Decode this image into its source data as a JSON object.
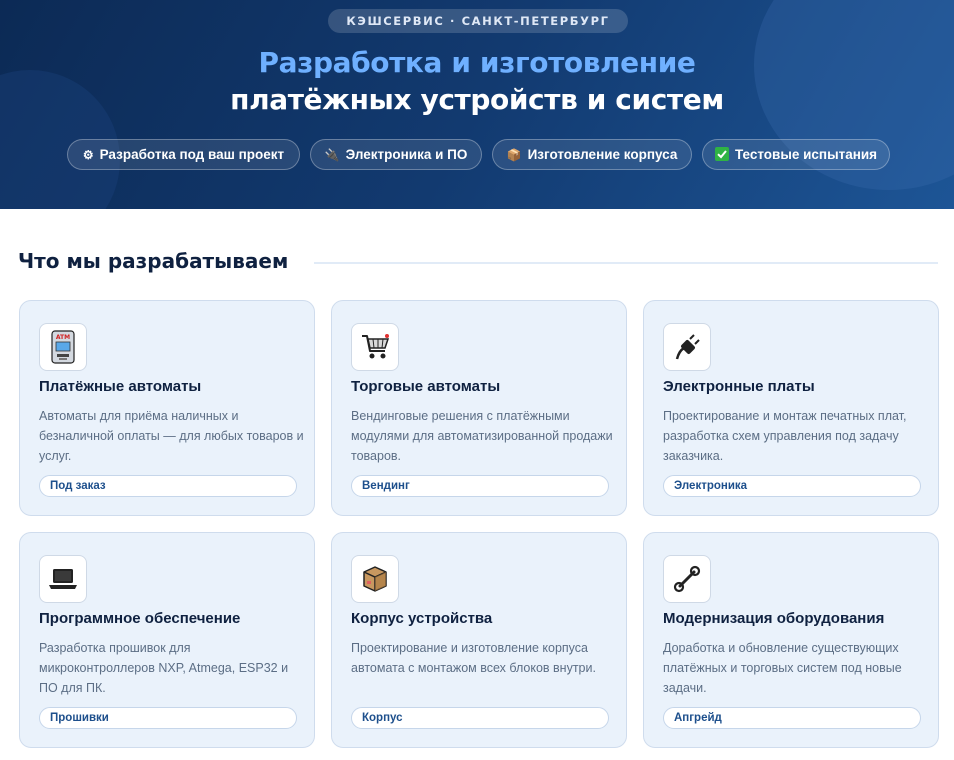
{
  "hero": {
    "badge": "КЭШСЕРВИС · САНКТ-ПЕТЕРБУРГ",
    "title_line1": "Разработка и изготовление",
    "title_line2": "платёжных устройств и систем",
    "chips": [
      {
        "icon": "⚙",
        "icon_name": "gear-icon",
        "label": "Разработка под ваш проект"
      },
      {
        "icon": "🔌",
        "icon_name": "plug-icon",
        "label": "Электроника и ПО"
      },
      {
        "icon": "📦",
        "icon_name": "box-icon",
        "label": "Изготовление корпуса"
      },
      {
        "icon": "✔",
        "icon_name": "checkmark-icon",
        "label": "Тестовые испытания"
      }
    ]
  },
  "section": {
    "title": "Что мы разрабатываем"
  },
  "cards": [
    {
      "icon_name": "atm-icon",
      "title": "Платёжные автоматы",
      "description": "Автоматы для приёма наличных и безналичной оплаты — для любых товаров и услуг.",
      "tag": "Под заказ",
      "atm_label": "ATM"
    },
    {
      "icon_name": "shopping-cart-icon",
      "title": "Торговые автоматы",
      "description": "Вендинговые решения с платёжными модулями для автоматизированной продажи товаров.",
      "tag": "Вендинг"
    },
    {
      "icon_name": "plug-icon",
      "title": "Электронные платы",
      "description": "Проектирование и монтаж печатных плат, разработка схем управления под задачу заказчика.",
      "tag": "Электроника"
    },
    {
      "icon_name": "laptop-icon",
      "title": "Программное обеспечение",
      "description": "Разработка прошивок для микроконтроллеров NXP, Atmega, ESP32 и ПО для ПК.",
      "tag": "Прошивки"
    },
    {
      "icon_name": "package-box-icon",
      "title": "Корпус устройства",
      "description": "Проектирование и изготовление корпуса автомата с монтажом всех блоков внутри.",
      "tag": "Корпус"
    },
    {
      "icon_name": "wrench-icon",
      "title": "Модернизация оборудования",
      "description": "Доработка и обновление существующих платёжных и торговых систем под новые задачи.",
      "tag": "Апгрейд"
    }
  ],
  "colors": {
    "hero_gradient_start": "#0c2a55",
    "hero_gradient_end": "#1d5596",
    "title_accent": "#6fb0ff",
    "card_bg": "#eaf2fb",
    "tag_text": "#1d4f8c"
  }
}
